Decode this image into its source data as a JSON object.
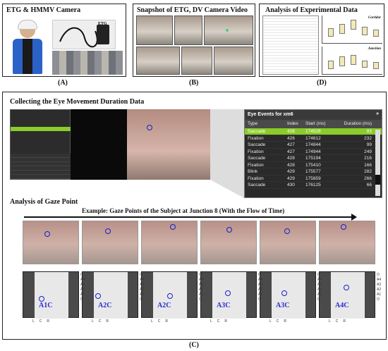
{
  "panel_a": {
    "title": "ETG & HMMV Camera",
    "device_label": "ETG",
    "caption": "(A)"
  },
  "panel_b": {
    "title": "Snapshot of ETG, DV Camera Video",
    "caption": "(B)"
  },
  "panel_d": {
    "title": "Analysis of Experimental Data",
    "chart1_label": "Corridor",
    "chart2_label": "Junction",
    "caption": "(D)"
  },
  "panel_c": {
    "caption": "(C)",
    "section1_title": "Collecting the Eye Movement Duration Data",
    "section2_title": "Analysis of Gaze Point",
    "sequence_title": "Example: Gaze Points of the Subject at Junction 8 (With the Flow of Time)",
    "eye_events": {
      "title": "Eye Events for xm6",
      "columns": [
        "Type",
        "Index",
        "Start (ms)",
        "Duration (ms)"
      ],
      "rows": [
        [
          "Saccade",
          "426",
          "174528",
          "83"
        ],
        [
          "Fixation",
          "426",
          "174612",
          "232"
        ],
        [
          "Saccade",
          "427",
          "174844",
          "99"
        ],
        [
          "Fixation",
          "427",
          "174944",
          "249"
        ],
        [
          "Saccade",
          "428",
          "175194",
          "216"
        ],
        [
          "Fixation",
          "428",
          "175410",
          "166"
        ],
        [
          "Blink",
          "429",
          "175577",
          "282"
        ],
        [
          "Fixation",
          "429",
          "175859",
          "266"
        ],
        [
          "Saccade",
          "430",
          "176125",
          "66"
        ]
      ]
    },
    "gaze_labels": [
      "A1C",
      "A2C",
      "A2C",
      "A3C",
      "A3C",
      "A4C"
    ],
    "axis_labels": [
      "L",
      "C",
      "R"
    ],
    "side_labels": [
      "O",
      "A4",
      "A3",
      "A2",
      "A1",
      "O"
    ]
  }
}
